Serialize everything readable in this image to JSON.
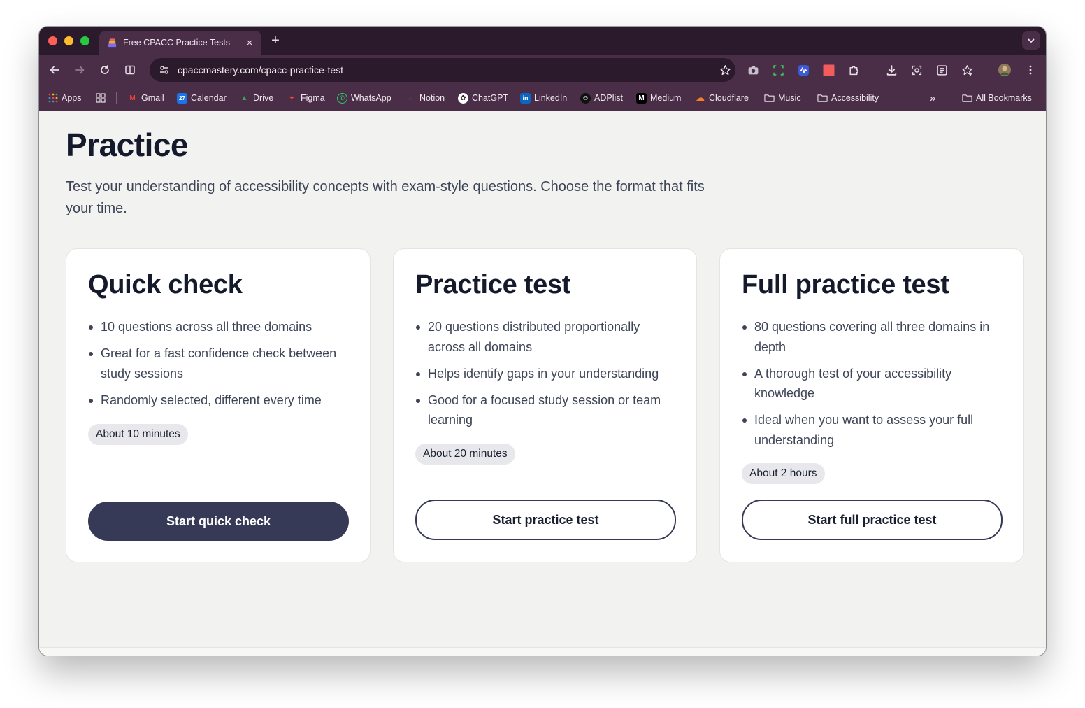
{
  "browser": {
    "tab_title": "Free CPACC Practice Tests —",
    "tab_close": "×",
    "new_tab": "+",
    "url": "cpaccmastery.com/cpacc-practice-test",
    "bookmarks": [
      {
        "label": "Apps",
        "icon": "apps-grid-icon"
      },
      {
        "label": "Gmail",
        "icon": "gmail-icon",
        "glyph": "M",
        "color": "#ea4335"
      },
      {
        "label": "Calendar",
        "icon": "calendar-icon",
        "glyph": "27",
        "color": "#1a73e8"
      },
      {
        "label": "Drive",
        "icon": "drive-icon",
        "glyph": "▲",
        "color": "#34a853"
      },
      {
        "label": "Figma",
        "icon": "figma-icon",
        "glyph": "✦",
        "color": "#f24e1e"
      },
      {
        "label": "WhatsApp",
        "icon": "whatsapp-icon",
        "glyph": "✆",
        "color": "#25d366"
      },
      {
        "label": "Notion",
        "icon": "notion-icon",
        "glyph": "⌂",
        "color": "#5b4458"
      },
      {
        "label": "ChatGPT",
        "icon": "chatgpt-icon",
        "glyph": "✿",
        "color": "#ffffff"
      },
      {
        "label": "LinkedIn",
        "icon": "linkedin-icon",
        "glyph": "in",
        "color": "#0a66c2"
      },
      {
        "label": "ADPlist",
        "icon": "adplist-icon",
        "glyph": "☺",
        "color": "#111111"
      },
      {
        "label": "Medium",
        "icon": "medium-icon",
        "glyph": "M",
        "color": "#000000"
      },
      {
        "label": "Cloudflare",
        "icon": "cloudflare-icon",
        "glyph": "☁",
        "color": "#f48120"
      },
      {
        "label": "Music",
        "icon": "folder-icon"
      },
      {
        "label": "Accessibility",
        "icon": "folder-icon"
      }
    ],
    "overflow": "»",
    "all_bookmarks": "All Bookmarks"
  },
  "page": {
    "title": "Practice",
    "intro": "Test your understanding of accessibility concepts with exam-style questions. Choose the format that fits your time."
  },
  "cards": [
    {
      "title": "Quick check",
      "items": [
        "10 questions across all three domains",
        "Great for a fast confidence check between study sessions",
        "Randomly selected, different every time"
      ],
      "duration": "About 10 minutes",
      "button": "Start quick check"
    },
    {
      "title": "Practice test",
      "items": [
        "20 questions distributed proportionally across all domains",
        "Helps identify gaps in your understanding",
        "Good for a focused study session or team learning"
      ],
      "duration": "About 20 minutes",
      "button": "Start practice test"
    },
    {
      "title": "Full practice test",
      "items": [
        "80 questions covering all three domains in depth",
        "A thorough test of your accessibility knowledge",
        "Ideal when you want to assess your full understanding"
      ],
      "duration": "About 2 hours",
      "button": "Start full practice test"
    }
  ],
  "colors": {
    "browser_frame": "#2a1a2b",
    "toolbar": "#4a2e48",
    "page_bg": "#f2f2f0",
    "heading": "#141a2b",
    "body_text": "#3d4456",
    "button_primary": "#363a56",
    "badge_bg": "#e8e8ec"
  }
}
